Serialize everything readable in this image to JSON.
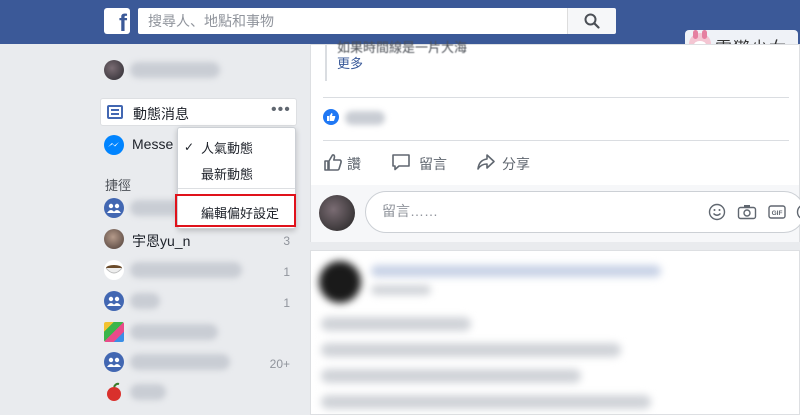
{
  "topbar": {
    "logo_letter": "f",
    "search_placeholder": "搜尋人、地點和事物"
  },
  "watermark": {
    "text": "電獺少女"
  },
  "sidebar": {
    "newsfeed_label": "動態消息",
    "more_label": "•••",
    "messenger_label": "Messe",
    "shortcuts_heading": "捷徑",
    "shortcuts": [
      {
        "label": "",
        "count": ""
      },
      {
        "label": "宇恩yu_n",
        "count": "3"
      },
      {
        "label": "",
        "count": "1"
      },
      {
        "label": "",
        "count": "1"
      },
      {
        "label": "",
        "count": ""
      },
      {
        "label": "",
        "count": "20+"
      },
      {
        "label": "",
        "count": ""
      }
    ]
  },
  "sort_menu": {
    "top_stories": "人氣動態",
    "most_recent": "最新動態",
    "edit_preferences": "編輯偏好設定",
    "checked": "✓"
  },
  "post": {
    "truncated_text": "如果時間線是一片大海",
    "more_link": "更多",
    "actions": {
      "like": "讚",
      "comment": "留言",
      "share": "分享"
    },
    "comment_placeholder": "留言……"
  },
  "colors": {
    "brand": "#3b5998",
    "highlight": "#e0121b",
    "link": "#385898"
  }
}
